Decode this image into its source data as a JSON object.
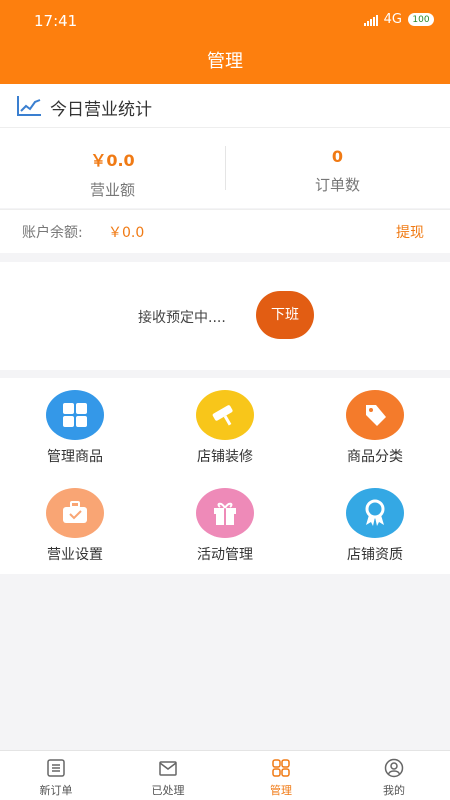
{
  "status_bar": {
    "time": "17:41",
    "network": "4G",
    "battery": "100"
  },
  "header": {
    "title": "管理"
  },
  "stats": {
    "heading": "今日营业统计",
    "revenue_value": "￥0.0",
    "revenue_label": "营业额",
    "orders_value": "0",
    "orders_label": "订单数"
  },
  "balance": {
    "label": "账户余额:",
    "value": "￥0.0",
    "withdraw_label": "提现"
  },
  "booking": {
    "status_text": "接收预定中....",
    "off_duty_label": "下班"
  },
  "menu": {
    "items": [
      {
        "label": "管理商品",
        "icon": "grid-icon",
        "color": "#3498e8"
      },
      {
        "label": "店铺装修",
        "icon": "paint-roller-icon",
        "color": "#f8c61a"
      },
      {
        "label": "商品分类",
        "icon": "tag-icon",
        "color": "#f47b2b"
      },
      {
        "label": "营业设置",
        "icon": "briefcase-icon",
        "color": "#f9a574"
      },
      {
        "label": "活动管理",
        "icon": "gift-icon",
        "color": "#ee8ab8"
      },
      {
        "label": "店铺资质",
        "icon": "award-icon",
        "color": "#34a8e4"
      }
    ]
  },
  "tabbar": {
    "items": [
      {
        "label": "新订单",
        "icon": "order-list-icon"
      },
      {
        "label": "已处理",
        "icon": "processed-mail-icon"
      },
      {
        "label": "管理",
        "icon": "manage-grid-icon"
      },
      {
        "label": "我的",
        "icon": "profile-icon"
      }
    ],
    "active_index": 2
  },
  "colors": {
    "brand": "#fd7f0e",
    "accent_text": "#f07a14",
    "button": "#e25d13"
  }
}
